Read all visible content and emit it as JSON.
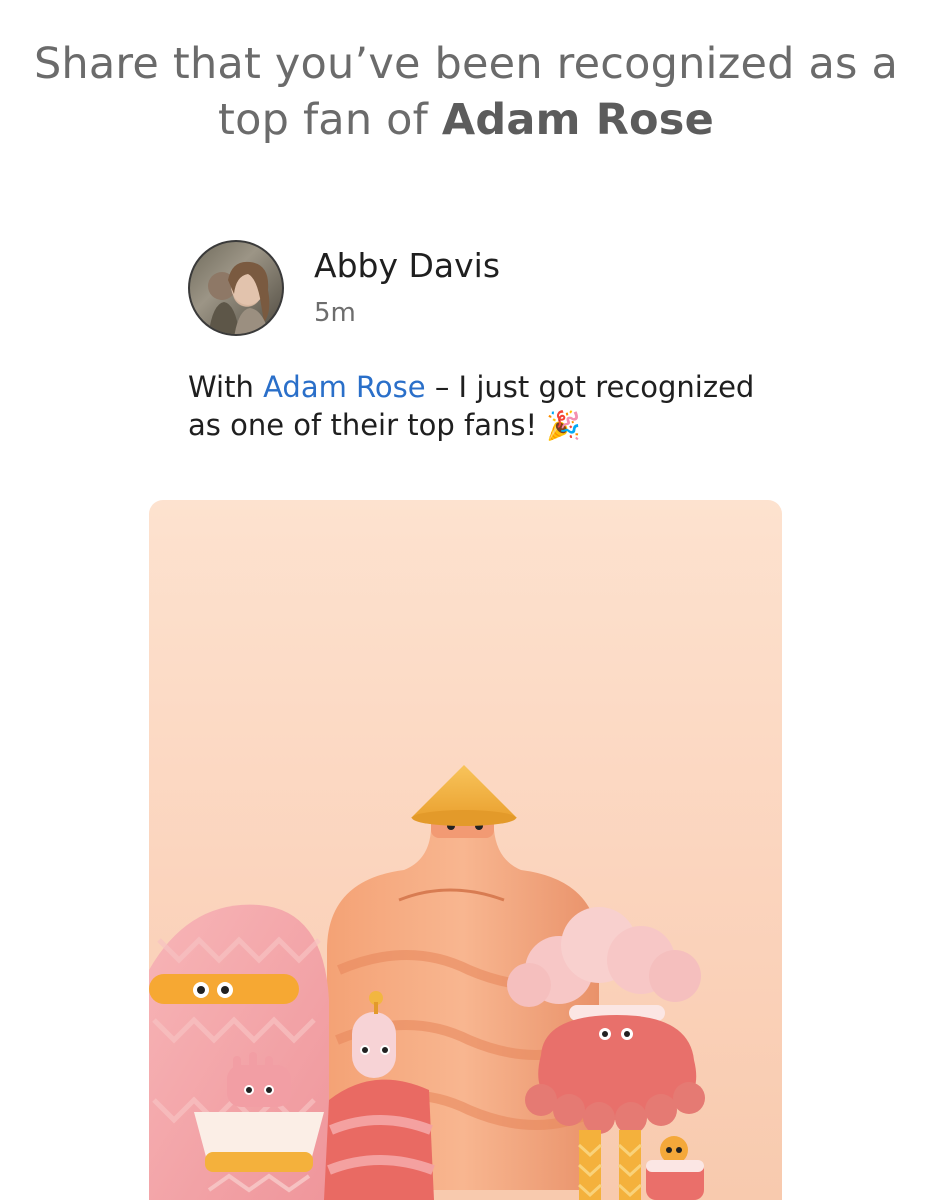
{
  "share_prompt": {
    "line1": "Share that you’ve been recognized as a",
    "line2_prefix": "top fan of ",
    "artist_name": "Adam Rose"
  },
  "post": {
    "author_name": "Abby Davis",
    "timestamp": "5m",
    "text_prefix": "With ",
    "mention": "Adam Rose",
    "text_line1_suffix": " – I just got recognized",
    "text_line2": "as one of their top fans! ",
    "emoji": "🎉"
  },
  "image": {
    "icon": "top-fan-illustration",
    "colors": {
      "background_top": "#fde2cf",
      "background_bottom": "#f8caae",
      "accent_orange": "#f0a36a",
      "accent_pink": "#f3a5a8",
      "accent_yellow": "#f2b640"
    }
  }
}
